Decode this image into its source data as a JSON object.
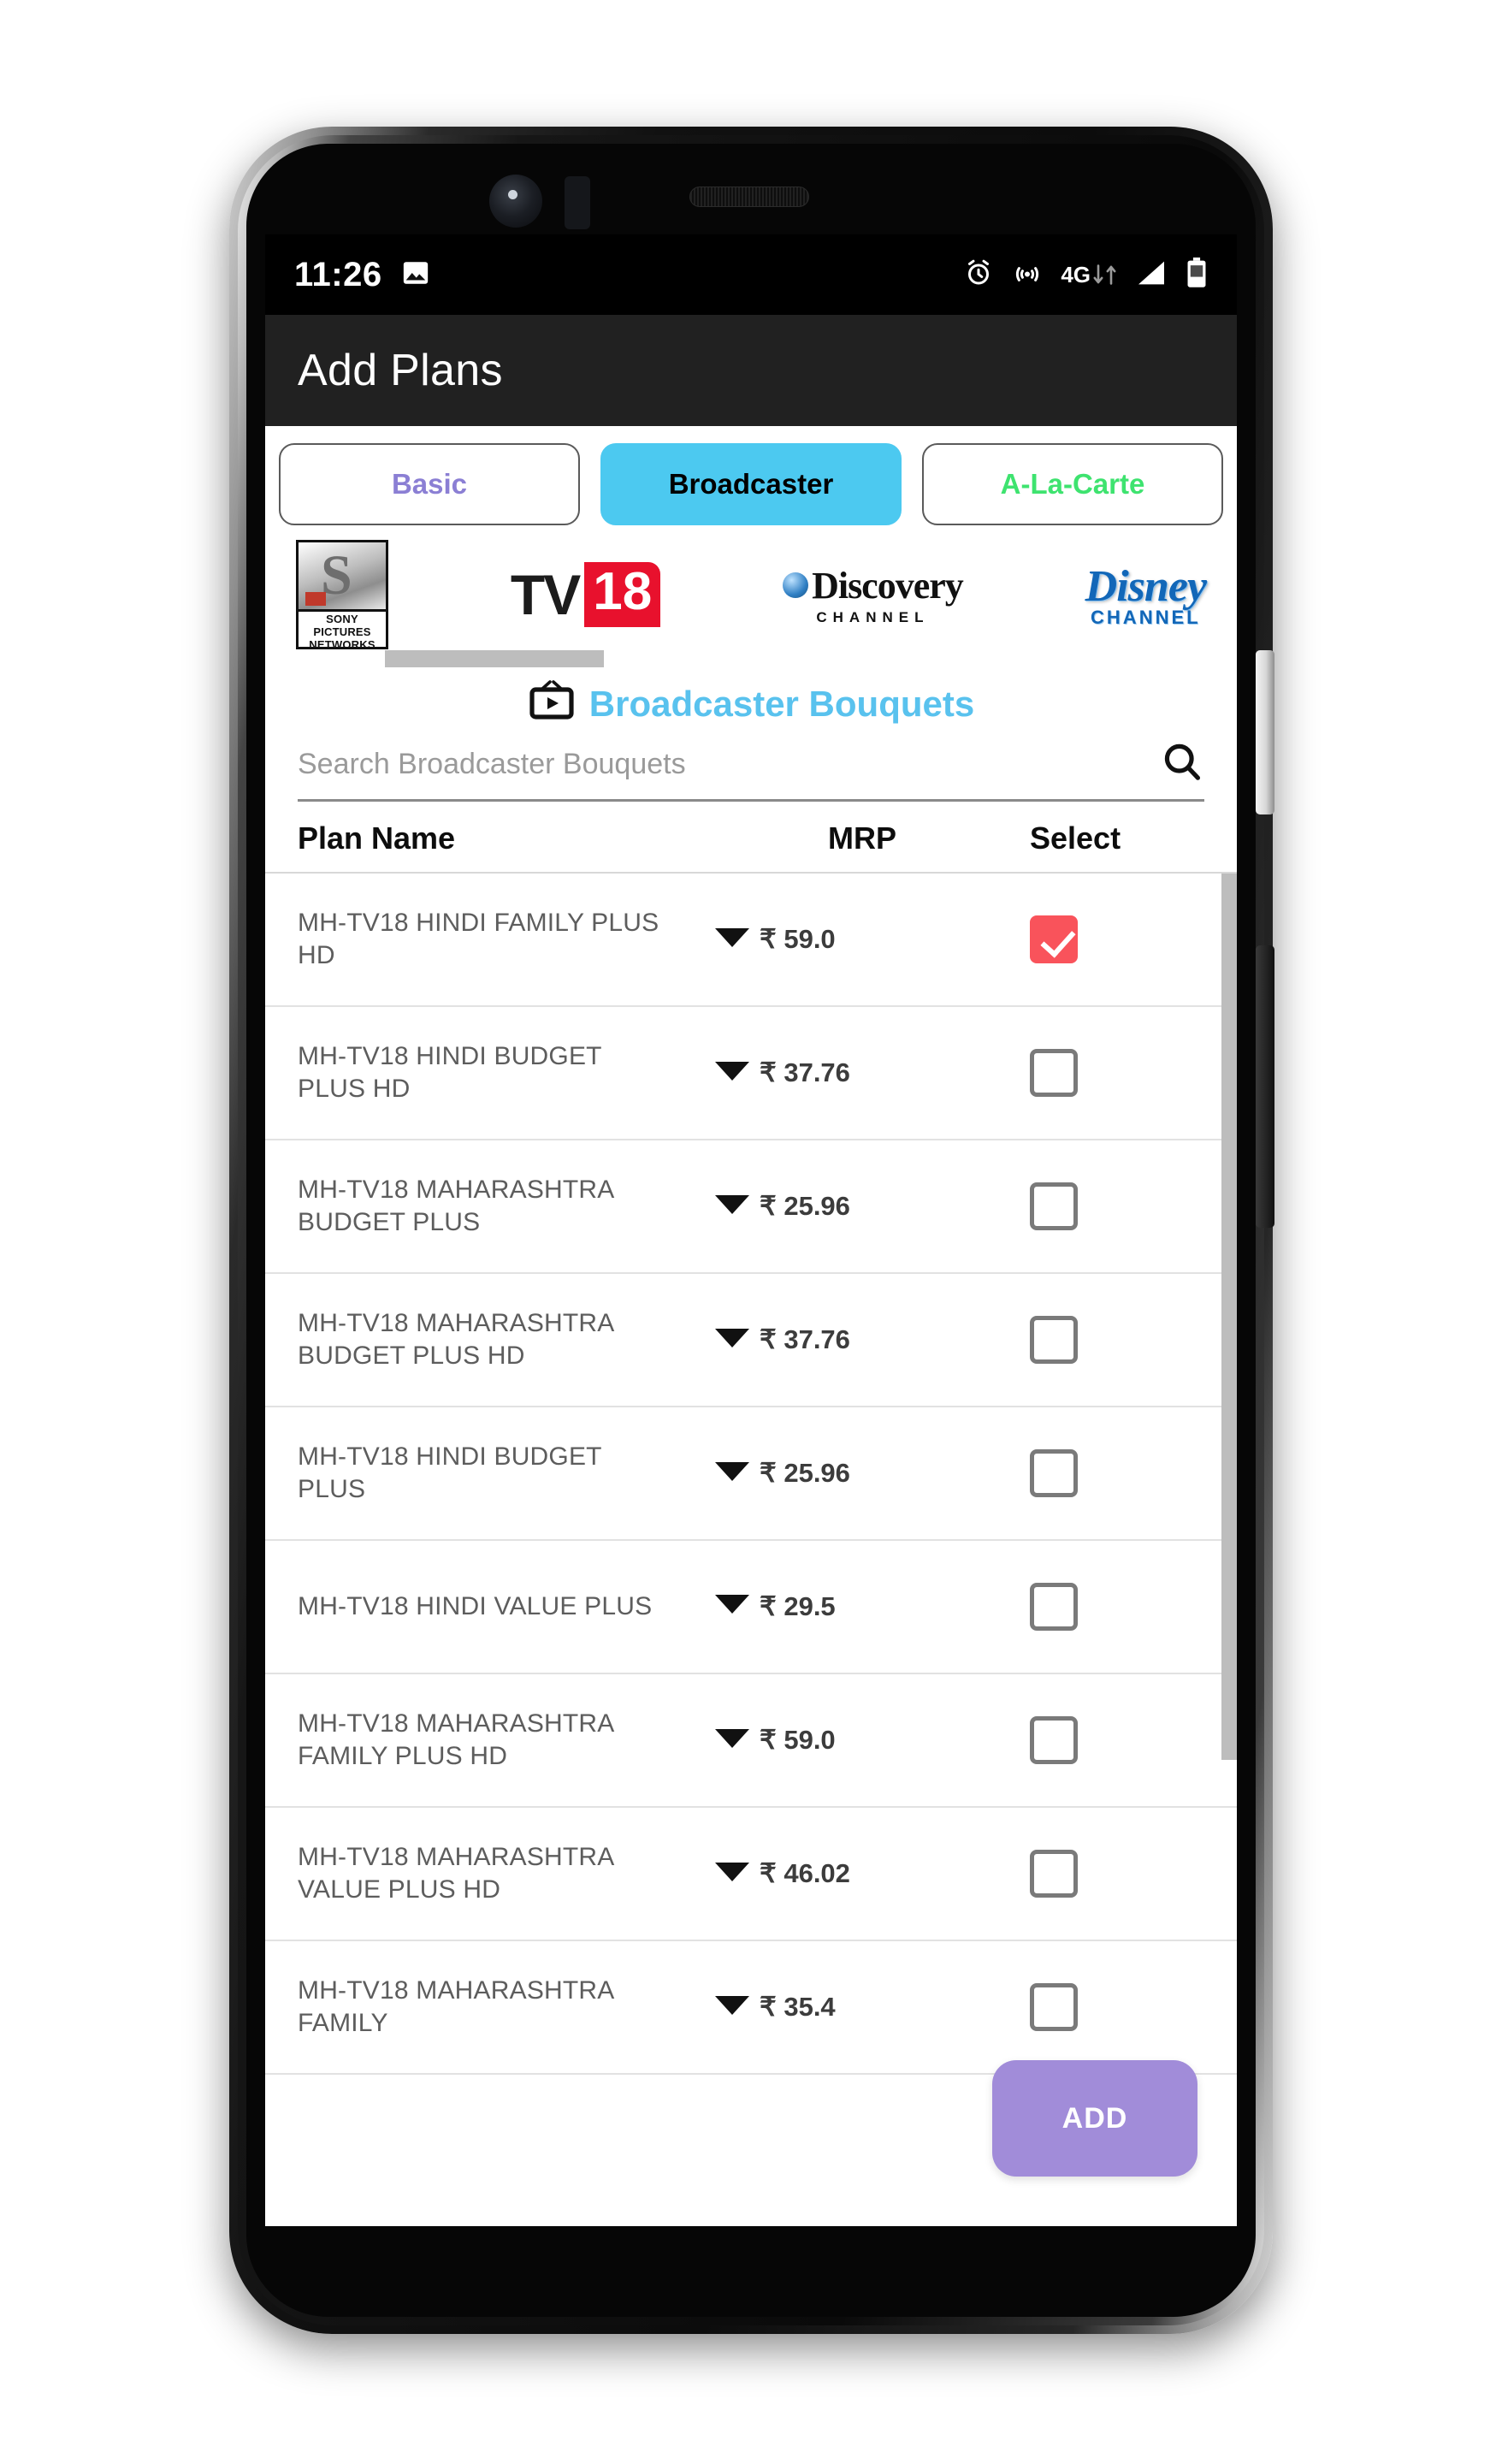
{
  "statusbar": {
    "time": "11:26",
    "icons_left": [
      "image-icon"
    ],
    "icons_right": [
      "alarm-icon",
      "hotspot-icon",
      "4g-icon",
      "signal-icon",
      "battery-icon"
    ],
    "network_label": "4G"
  },
  "appbar": {
    "title": "Add Plans"
  },
  "tabs": [
    {
      "label": "Basic",
      "active": false,
      "color": "#8b7fd4"
    },
    {
      "label": "Broadcaster",
      "active": true,
      "color": "#000000"
    },
    {
      "label": "A-La-Carte",
      "active": false,
      "color": "#3ee36f"
    }
  ],
  "broadcasters": [
    {
      "name": "sony-pictures-networks-logo",
      "line1": "SONY",
      "line2": "PICTURES",
      "line3": "NETWORKS",
      "glyph": "S"
    },
    {
      "name": "tv18-logo",
      "part1": "TV",
      "part2": "18"
    },
    {
      "name": "discovery-channel-logo",
      "word": "Discovery",
      "sub": "CHANNEL"
    },
    {
      "name": "disney-channel-logo",
      "word": "Disney",
      "sub": "CHANNEL"
    }
  ],
  "section": {
    "icon": "tv-play-icon",
    "title": "Broadcaster Bouquets",
    "title_color": "#59c2ee"
  },
  "search": {
    "placeholder": "Search Broadcaster Bouquets",
    "value": "",
    "icon": "search-icon"
  },
  "table": {
    "headers": {
      "name": "Plan Name",
      "mrp": "MRP",
      "select": "Select"
    },
    "rows": [
      {
        "plan": "MH-TV18 HINDI FAMILY PLUS HD",
        "mrp": "₹ 59.0",
        "selected": true
      },
      {
        "plan": "MH-TV18 HINDI BUDGET PLUS HD",
        "mrp": "₹ 37.76",
        "selected": false
      },
      {
        "plan": "MH-TV18 MAHARASHTRA BUDGET PLUS",
        "mrp": "₹ 25.96",
        "selected": false
      },
      {
        "plan": "MH-TV18 MAHARASHTRA BUDGET PLUS HD",
        "mrp": "₹ 37.76",
        "selected": false
      },
      {
        "plan": "MH-TV18 HINDI BUDGET PLUS",
        "mrp": "₹ 25.96",
        "selected": false
      },
      {
        "plan": "MH-TV18 HINDI VALUE PLUS",
        "mrp": "₹ 29.5",
        "selected": false
      },
      {
        "plan": "MH-TV18 MAHARASHTRA FAMILY PLUS HD",
        "mrp": "₹ 59.0",
        "selected": false
      },
      {
        "plan": "MH-TV18 MAHARASHTRA VALUE PLUS HD",
        "mrp": "₹ 46.02",
        "selected": false
      },
      {
        "plan": "MH-TV18 MAHARASHTRA FAMILY",
        "mrp": "₹ 35.4",
        "selected": false
      }
    ]
  },
  "fab": {
    "label": "ADD",
    "color": "#a18cd9"
  },
  "navbar": {
    "items": [
      "back-icon",
      "home-icon",
      "recents-icon"
    ]
  },
  "colors": {
    "accent_cyan": "#4cc9f0",
    "checkbox_checked": "#f9535b",
    "appbar_bg": "#212121",
    "fab": "#a18cd9"
  }
}
